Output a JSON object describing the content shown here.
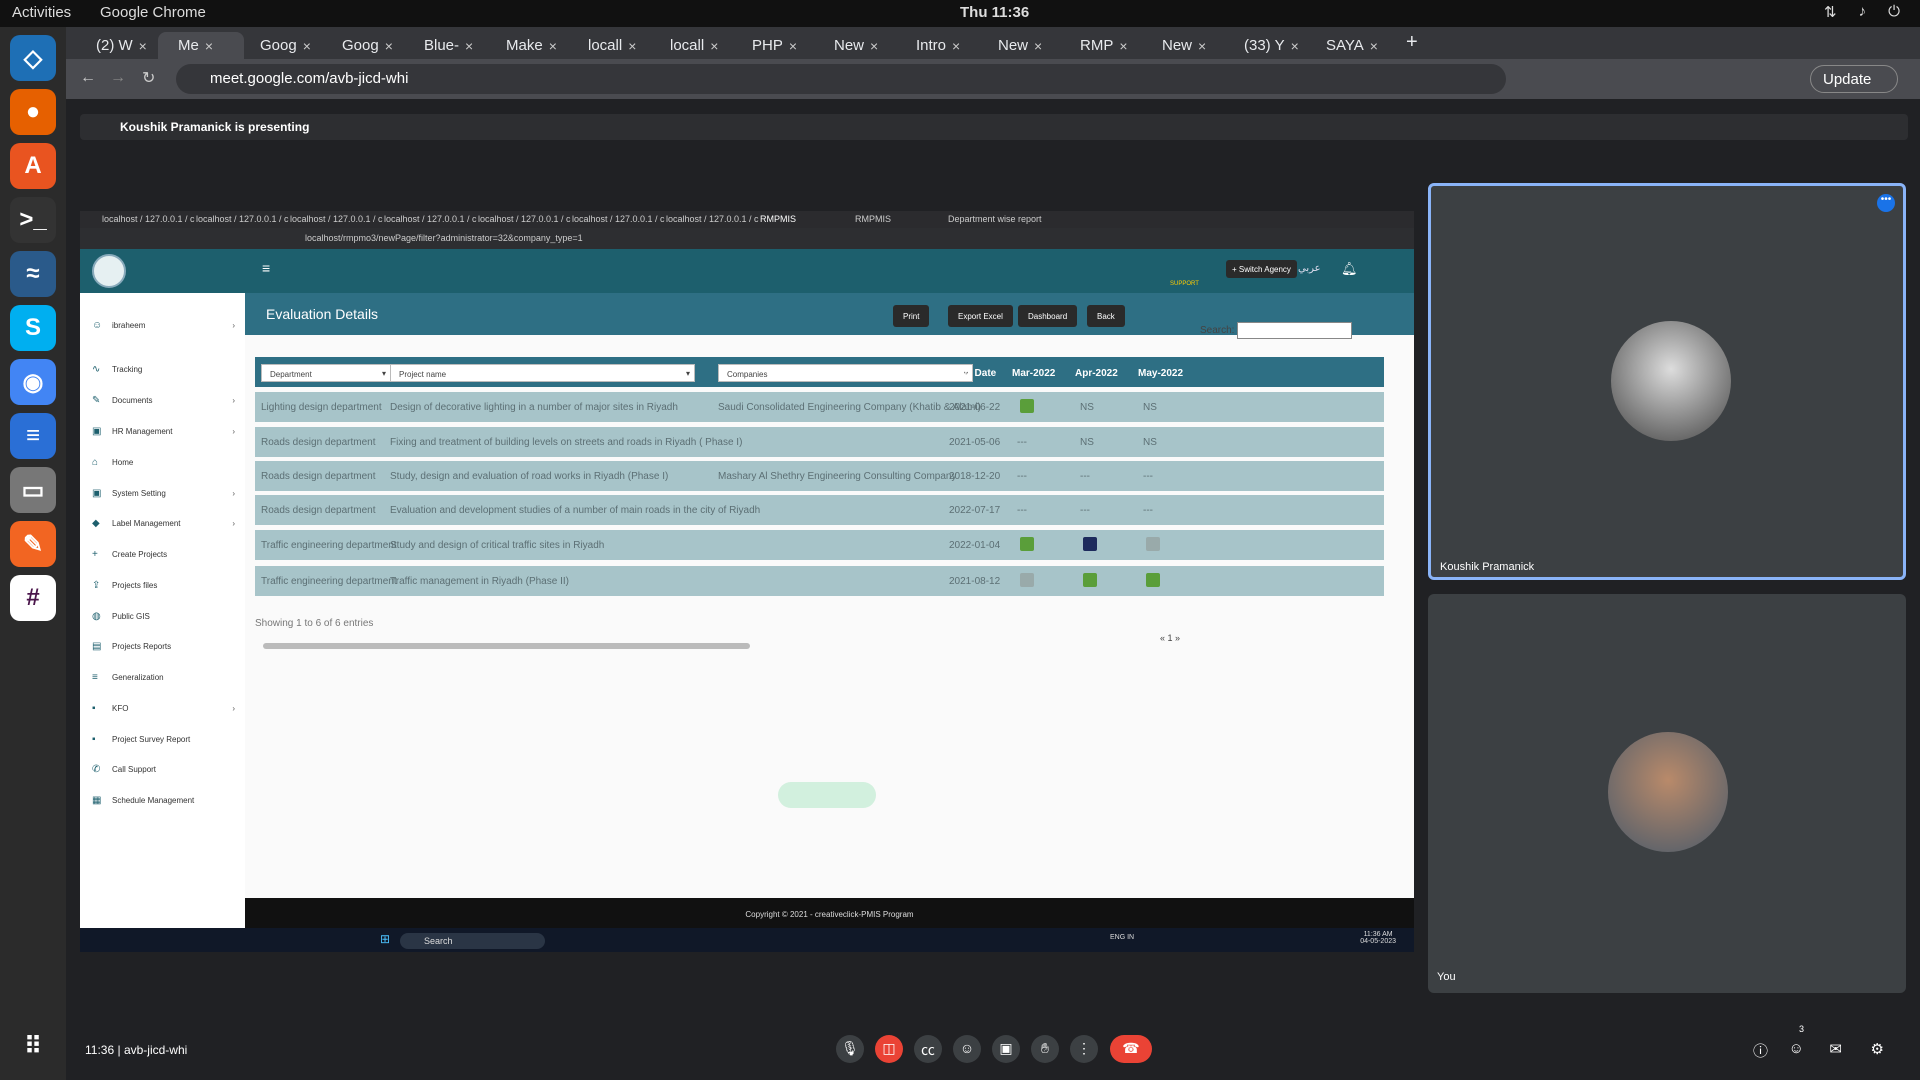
{
  "os": {
    "activities": "Activities",
    "app_name": "Google Chrome",
    "clock": "Thu 11:36"
  },
  "chrome": {
    "tabs": [
      "(2) W",
      "Me",
      "Goog",
      "Goog",
      "Blue-",
      "Make",
      "locall",
      "locall",
      "PHP",
      "New",
      "Intro",
      "New",
      "RMP",
      "New",
      "(33) Y",
      "SAYA"
    ],
    "url": "meet.google.com/avb-jicd-whi",
    "update_label": "Update"
  },
  "meet": {
    "presenting": "Koushik Pramanick is presenting",
    "participants": [
      {
        "name": "Koushik Pramanick"
      },
      {
        "name": "You"
      }
    ],
    "time": "11:36",
    "code": "avb-jicd-whi",
    "participant_count": "3"
  },
  "remote": {
    "tabs": [
      "localhost / 127.0.0.1 / c",
      "localhost / 127.0.0.1 / c",
      "localhost / 127.0.0.1 / c",
      "localhost / 127.0.0.1 / c",
      "localhost / 127.0.0.1 / c",
      "localhost / 127.0.0.1 / c",
      "localhost / 127.0.0.1 / c",
      "RMPMIS",
      "RMPMIS",
      "Department wise report"
    ],
    "url": "localhost/rmpmo3/newPage/filter?administrator=32&company_type=1",
    "header": {
      "support": "SUPPORT",
      "switch_agency": "+ Switch Agency",
      "arabic": "عربي"
    },
    "sidebar": {
      "user": "ibraheem",
      "items": [
        "Tracking",
        "Documents",
        "HR Management",
        "Home",
        "System Setting",
        "Label Management",
        "Create Projects",
        "Projects files",
        "Public GIS",
        "Projects Reports",
        "Generalization",
        "KFO",
        "Project Survey Report",
        "Call Support",
        "Schedule Management"
      ]
    },
    "page": {
      "title": "Evaluation Details",
      "buttons": {
        "print": "Print",
        "export": "Export Excel",
        "dashboard": "Dashboard",
        "back": "Back"
      },
      "search_label": "Search:",
      "filters": {
        "department": "Department",
        "project": "Project name",
        "companies": "Companies"
      },
      "columns": [
        "Start Date",
        "Mar-2022",
        "Apr-2022",
        "May-2022"
      ],
      "rows": [
        {
          "dept": "Lighting design department",
          "project": "Design of decorative lighting in a number of major sites in Riyadh",
          "company": "Saudi Consolidated Engineering Company (Khatib & Alami)",
          "date": "2021-06-22",
          "mar": "mark",
          "apr": "NS",
          "may": "NS"
        },
        {
          "dept": "Roads design department",
          "project": "Fixing and treatment of building levels on streets and roads in Riyadh ( Phase I)",
          "company": "",
          "date": "2021-05-06",
          "mar": "---",
          "apr": "NS",
          "may": "NS"
        },
        {
          "dept": "Roads design department",
          "project": "Study, design and evaluation of road works in Riyadh (Phase I)",
          "company": "Mashary Al Shethry Engineering Consulting Company",
          "date": "2018-12-20",
          "mar": "---",
          "apr": "---",
          "may": "---"
        },
        {
          "dept": "Roads design department",
          "project": "Evaluation and development studies of a number of main roads in the city of Riyadh",
          "company": "",
          "date": "2022-07-17",
          "mar": "---",
          "apr": "---",
          "may": "---"
        },
        {
          "dept": "Traffic engineering department",
          "project": "Study and design of critical traffic sites in Riyadh",
          "company": "",
          "date": "2022-01-04",
          "mar": "mark",
          "apr": "mark-navy",
          "may": "mark-grey"
        },
        {
          "dept": "Traffic engineering department",
          "project": "Traffic management in Riyadh (Phase II)",
          "company": "",
          "date": "2021-08-12",
          "mar": "mark-grey",
          "apr": "mark",
          "may": "mark"
        }
      ],
      "showing": "Showing 1 to 6 of 6 entries",
      "pager": "« 1 »",
      "footer": "Copyright © 2021 - creativeclick-PMIS Program"
    },
    "taskbar": {
      "search": "Search",
      "lang": "ENG IN",
      "time": "11:36 AM",
      "date": "04-05-2023"
    }
  },
  "colors": {
    "header": "#1d5f6d",
    "table_header": "#2e6f84",
    "row": "#a7c4c9",
    "mark_green": "#5a9e3a",
    "mark_navy": "#1d2b5c",
    "mark_grey": "#9aa",
    "speaker_border": "#8ab4f8",
    "end_call": "#ea4335"
  }
}
